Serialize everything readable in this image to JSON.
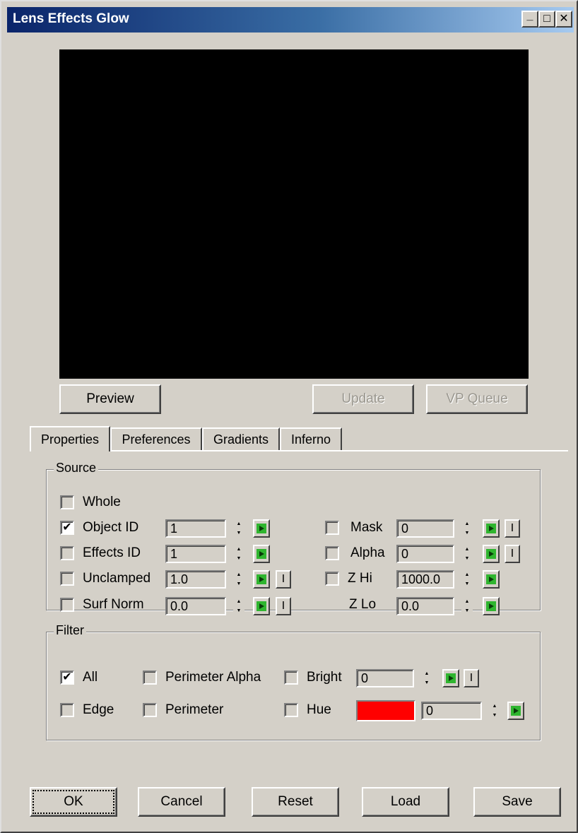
{
  "window": {
    "title": "Lens Effects Glow"
  },
  "caption_buttons": {
    "minimize": "_",
    "maximize": "□",
    "close": "✕"
  },
  "preview_buttons": {
    "preview": "Preview",
    "update": "Update",
    "vp_queue": "VP Queue"
  },
  "tabs": [
    {
      "label": "Properties",
      "active": true
    },
    {
      "label": "Preferences",
      "active": false
    },
    {
      "label": "Gradients",
      "active": false
    },
    {
      "label": "Inferno",
      "active": false
    }
  ],
  "source": {
    "label": "Source",
    "whole": {
      "label": "Whole",
      "checked": false
    },
    "object_id": {
      "label": "Object ID",
      "checked": true,
      "value": "1"
    },
    "effects_id": {
      "label": "Effects ID",
      "checked": false,
      "value": "1"
    },
    "unclamped": {
      "label": "Unclamped",
      "checked": false,
      "value": "1.0",
      "extra": "I"
    },
    "surf_norm": {
      "label": "Surf Norm",
      "checked": false,
      "value": "0.0",
      "extra": "I"
    },
    "mask": {
      "label": "Mask",
      "checked": false,
      "value": "0",
      "extra": "I"
    },
    "alpha": {
      "label": "Alpha",
      "checked": false,
      "value": "0",
      "extra": "I"
    },
    "z_hi": {
      "label": "Z Hi",
      "checked": false,
      "value": "1000.0"
    },
    "z_lo": {
      "label": "Z Lo",
      "value": "0.0"
    }
  },
  "filter": {
    "label": "Filter",
    "all": {
      "label": "All",
      "checked": true
    },
    "edge": {
      "label": "Edge",
      "checked": false
    },
    "perimeter_alpha": {
      "label": "Perimeter Alpha",
      "checked": false
    },
    "perimeter": {
      "label": "Perimeter",
      "checked": false
    },
    "bright": {
      "label": "Bright",
      "checked": false,
      "value": "0",
      "extra": "I"
    },
    "hue": {
      "label": "Hue",
      "checked": false,
      "value": "0",
      "color": "#ff0000"
    }
  },
  "dialog_buttons": {
    "ok": "OK",
    "cancel": "Cancel",
    "reset": "Reset",
    "load": "Load",
    "save": "Save"
  },
  "check_glyph": "✔",
  "colors": {
    "title_start": "#0a246a",
    "title_end": "#a6caf0",
    "face": "#d4d0c8",
    "anim_icon": "#2fb52f"
  }
}
